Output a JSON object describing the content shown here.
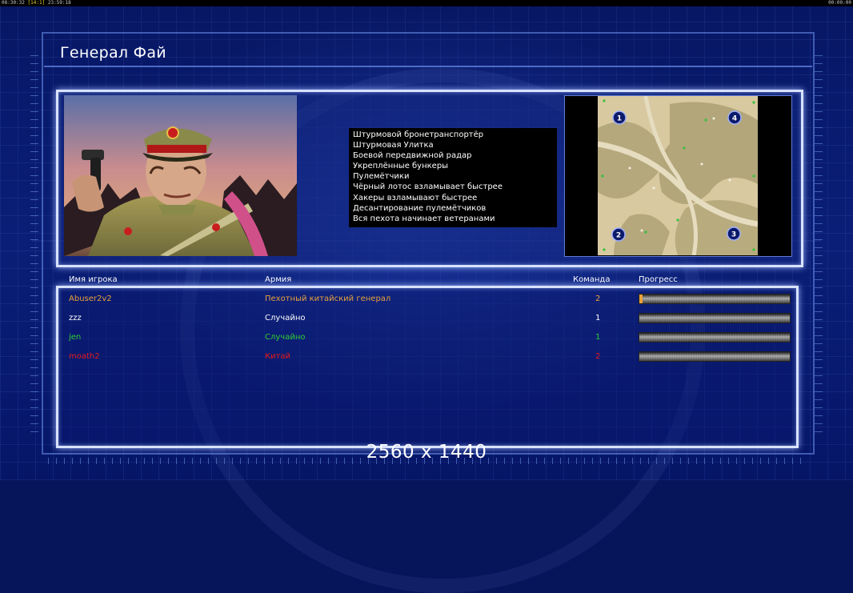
{
  "topbar": {
    "left_time": "08:30:32",
    "left_fps": "[14:1]",
    "left_clock": "23:59:18",
    "right_time": "00:00:00"
  },
  "screen": {
    "title": "Генерал Фай"
  },
  "bonuses": [
    "Штурмовой бронетранспортёр",
    "Штурмовая Улитка",
    "Боевой передвижной радар",
    "Укреплённые бункеры",
    "Пулемётчики",
    "Чёрный лотос взламывает быстрее",
    "Хакеры взламывают быстрее",
    "Десантирование пулемётчиков",
    "Вся пехота начинает ветеранами"
  ],
  "map": {
    "start_positions": [
      "1",
      "2",
      "3",
      "4"
    ]
  },
  "table": {
    "headers": {
      "player": "Имя игрока",
      "army": "Армия",
      "team": "Команда",
      "progress": "Прогресс"
    },
    "rows": [
      {
        "player": "Abuser2v2",
        "army": "Пехотный китайский генерал",
        "team": "2",
        "color": "#e8a23a",
        "progress": 0.02
      },
      {
        "player": "zzz",
        "army": "Случайно",
        "team": "1",
        "color": "#ffffff",
        "progress": 0
      },
      {
        "player": "jen",
        "army": "Случайно",
        "team": "1",
        "color": "#2fd02f",
        "progress": 0
      },
      {
        "player": "moath2",
        "army": "Китай",
        "team": "2",
        "color": "#e81818",
        "progress": 0
      }
    ]
  },
  "resolution_label": "2560 x 1440"
}
